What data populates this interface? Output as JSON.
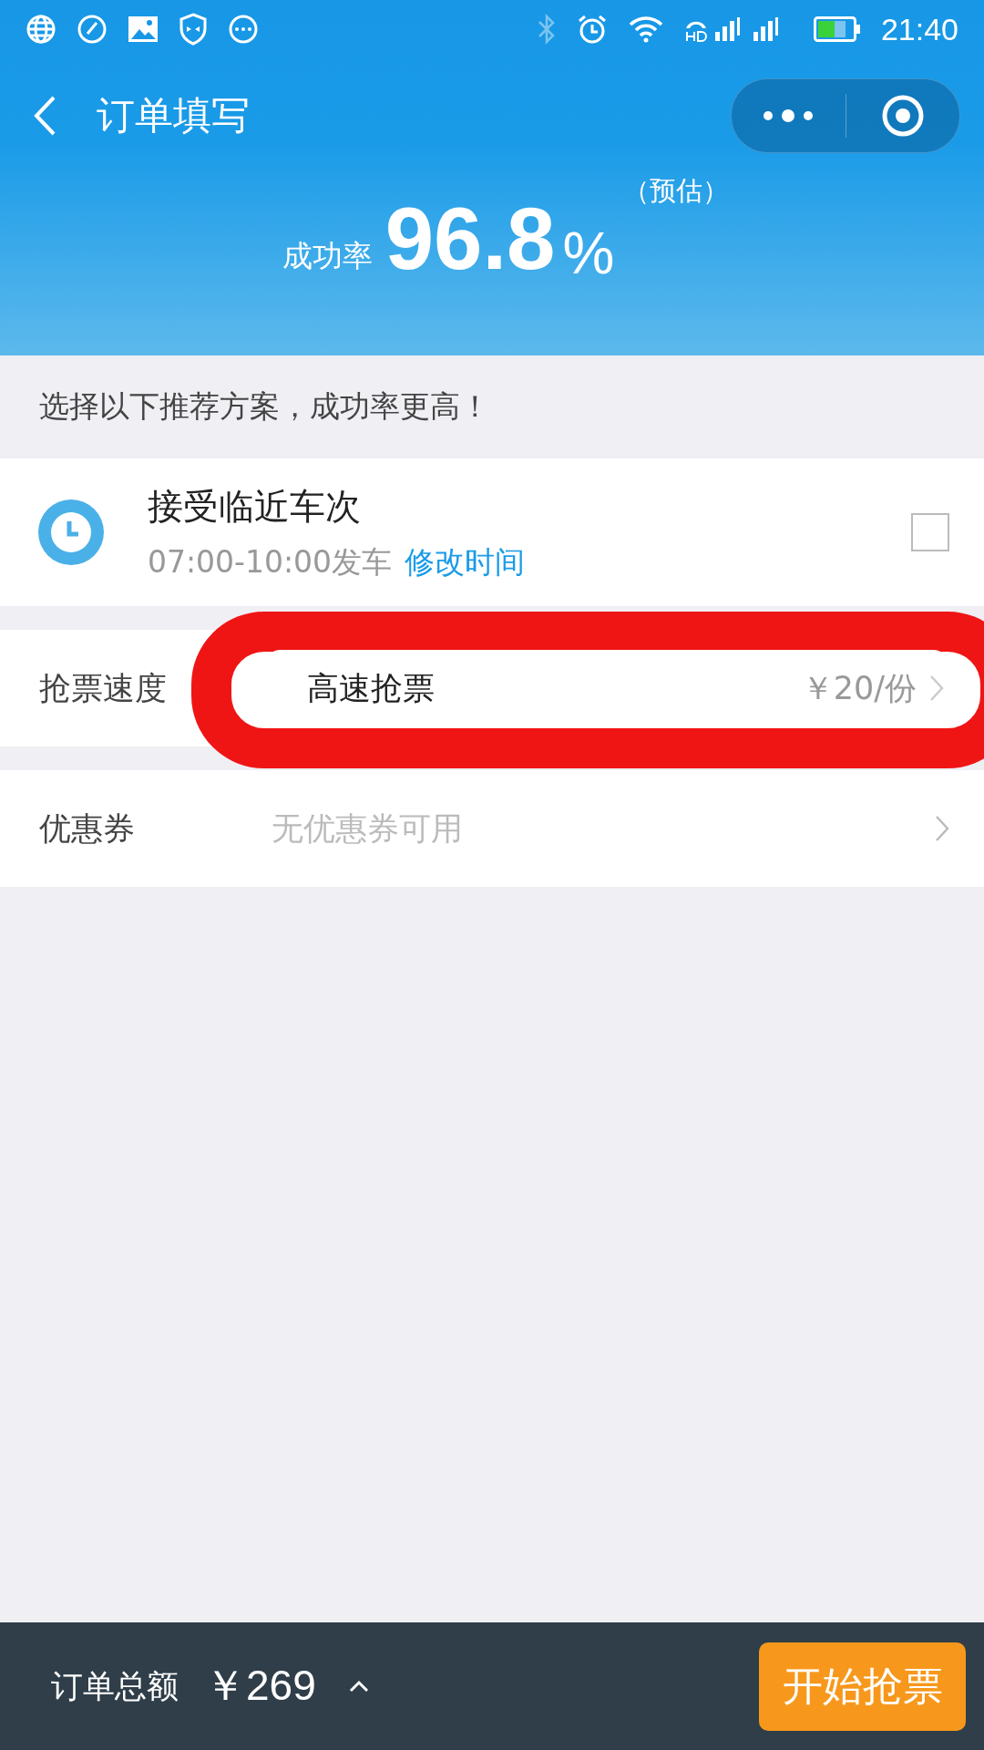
{
  "status_bar": {
    "time": "21:40"
  },
  "nav": {
    "title": "订单填写"
  },
  "success": {
    "label": "成功率",
    "value": "96.8",
    "unit": "%",
    "note": "（预估）"
  },
  "hint": "选择以下推荐方案，成功率更高！",
  "recommendation": {
    "title": "接受临近车次",
    "time": "07:00-10:00发车",
    "link": "修改时间",
    "checked": false
  },
  "rows": [
    {
      "label": "抢票速度",
      "value": "高速抢票",
      "extra": "￥20/份",
      "highlighted": true,
      "muted": false
    },
    {
      "label": "优惠券",
      "value": "无优惠券可用",
      "highlighted": false,
      "muted": true
    }
  ],
  "footer": {
    "label": "订单总额",
    "total": "￥269",
    "button": "开始抢票"
  }
}
